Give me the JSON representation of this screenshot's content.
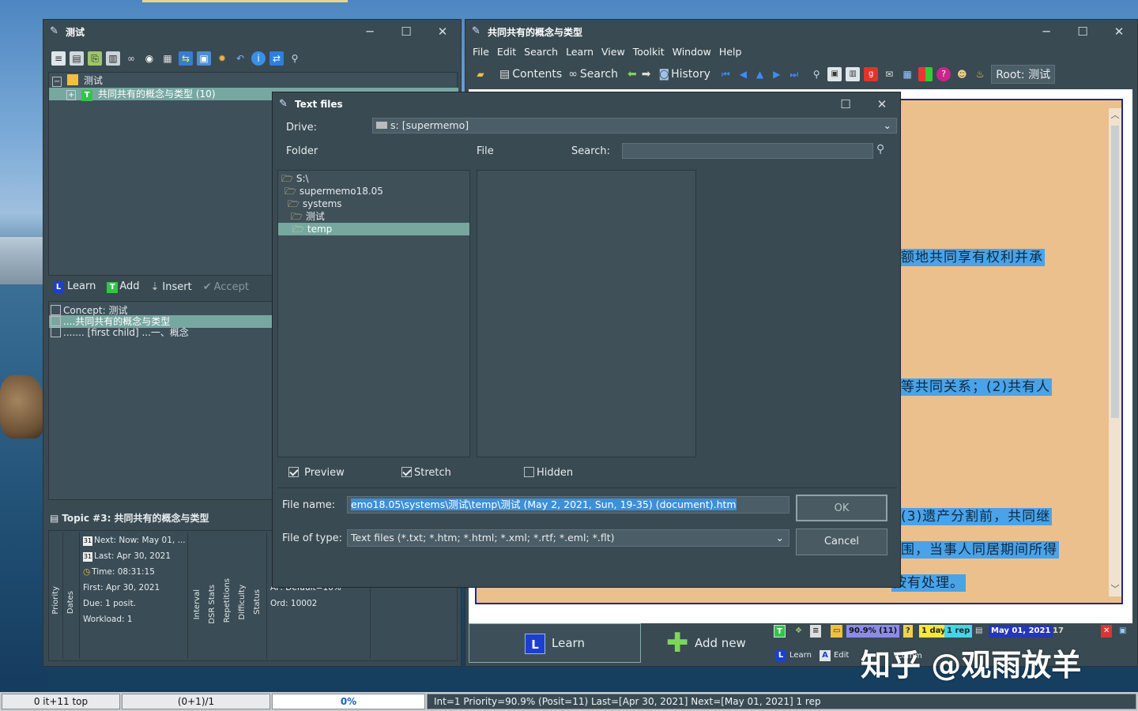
{
  "left_window": {
    "title": "测试",
    "tree": {
      "root": "测试",
      "child": "共同共有的概念与类型 (10)"
    },
    "actions": {
      "learn": "Learn",
      "add": "Add",
      "insert": "Insert",
      "accept": "Accept"
    },
    "concept_list": [
      "Concept: 测试",
      "....共同共有的概念与类型",
      "....... [first child] ...一、概念"
    ],
    "topic_title": "Topic #3: 共同共有的概念与类型",
    "stats": {
      "next": "Next: Now: May 01, ...",
      "last": "Last: Apr 30, 2021",
      "time": "Time: 08:31:15",
      "first": "First: Apr 30, 2021",
      "due": "Due: 1 posit.",
      "workload": "Workload: 1",
      "af": "AF: Default=10%",
      "ord": "Ord: 10002"
    },
    "stat_labels": [
      "Priority",
      "Dates",
      "Interval",
      "DSR Stats",
      "Repetitions",
      "Difficulty",
      "Status"
    ]
  },
  "right_window": {
    "title": "共同共有的概念与类型",
    "menu": [
      "File",
      "Edit",
      "Search",
      "Learn",
      "View",
      "Toolkit",
      "Window",
      "Help"
    ],
    "toolbar": {
      "contents": "Contents",
      "search": "Search",
      "history": "History",
      "root": "Root: 测试"
    },
    "text_lines": [
      "额地共同享有权利并承",
      "等共同关系；(2)共有人",
      "(3)遗产分割前，共同继",
      "围，当事人同居期间所得",
      "按有处理。"
    ],
    "learn_button": "Learn",
    "add_new_button": "Add new",
    "status_badges": {
      "priority": "90.9% (11)",
      "interval": "1 day",
      "reps": "1 rep",
      "date": "May 01, 2021"
    },
    "bottom_small": {
      "learn": "Learn",
      "edit": "Edit",
      "comm": "Comm"
    },
    "watermark": "知乎 @观雨放羊"
  },
  "dialog": {
    "title": "Text files",
    "drive_label": "Drive:",
    "drive_value": "s: [supermemo]",
    "folder_label": "Folder",
    "file_label": "File",
    "search_label": "Search:",
    "search_value": "",
    "folders": [
      "S:\\",
      "supermemo18.05",
      "systems",
      "测试",
      "temp"
    ],
    "preview": "Preview",
    "stretch": "Stretch",
    "hidden": "Hidden",
    "preview_checked": true,
    "stretch_checked": true,
    "hidden_checked": false,
    "file_name_label": "File name:",
    "file_name_value": "emo18.05\\systems\\测试\\temp\\测试 (May 2, 2021, Sun, 19-35) (document).htm",
    "file_type_label": "File of type:",
    "file_type_value": "Text files (*.txt; *.htm; *.html; *.xml; *.rtf; *.eml; *.flt)",
    "ok": "OK",
    "cancel": "Cancel"
  },
  "statusbar": {
    "left": "0 it+11 top",
    "mid": "(0+1)/1",
    "progress": "0%",
    "progress_fraction": 0.0,
    "info": "Int=1 Priority=90.9% (Posit=11) Last=[Apr 30, 2021] Next=[May 01, 2021] 1 rep"
  },
  "colors": {
    "selection": "#76a8a0",
    "highlight": "#4aa3e8",
    "element_bg": "#ecc08c",
    "window": "#394a52"
  }
}
